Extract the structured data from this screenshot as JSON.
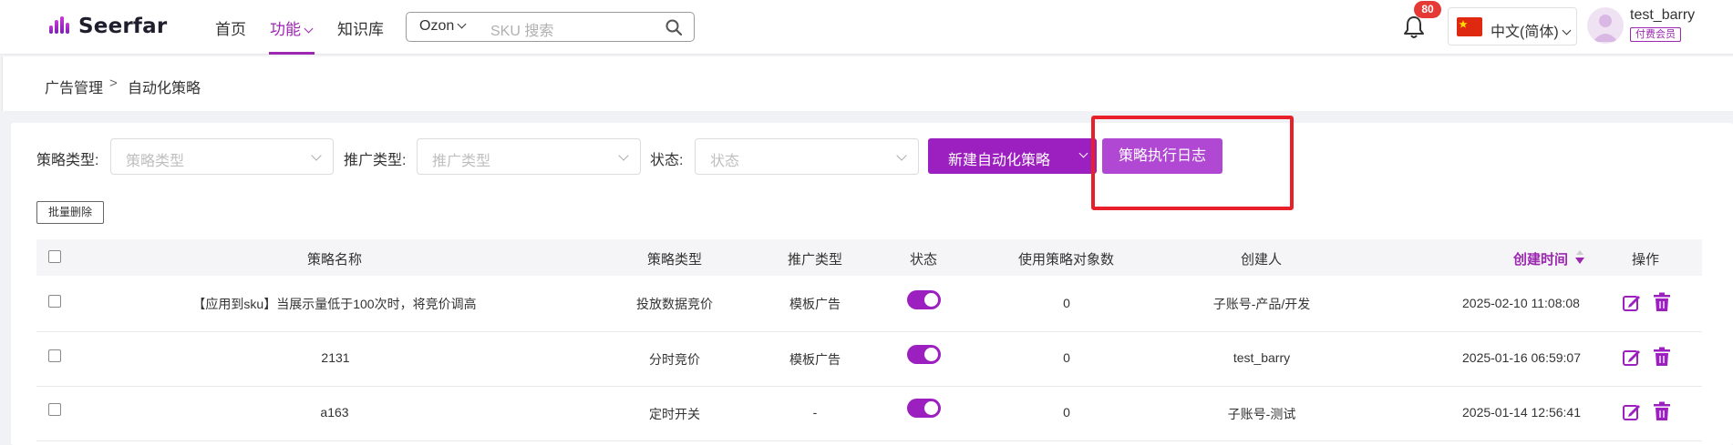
{
  "header": {
    "logo_text": "Seerfar",
    "nav": [
      {
        "label": "首页"
      },
      {
        "label": "功能"
      },
      {
        "label": "知识库"
      }
    ],
    "search": {
      "platform": "Ozon",
      "placeholder": "SKU 搜索"
    },
    "notifications": {
      "count": "80"
    },
    "language": {
      "label": "中文(简体)"
    },
    "user": {
      "name": "test_barry",
      "badge": "付费会员"
    }
  },
  "breadcrumb": {
    "items": [
      "广告管理",
      "自动化策略"
    ],
    "separator": ">"
  },
  "filters": {
    "strategy_type": {
      "label": "策略类型:",
      "placeholder": "策略类型"
    },
    "promo_type": {
      "label": "推广类型:",
      "placeholder": "推广类型"
    },
    "status": {
      "label": "状态:",
      "placeholder": "状态"
    }
  },
  "actions": {
    "new_strategy": "新建自动化策略",
    "execution_log": "策略执行日志",
    "batch_delete": "批量删除"
  },
  "table": {
    "columns": [
      "策略名称",
      "策略类型",
      "推广类型",
      "状态",
      "使用策略对象数",
      "创建人",
      "创建时间",
      "操作"
    ],
    "sorted_column": "创建时间",
    "rows": [
      {
        "name": "【应用到sku】当展示量低于100次时，将竞价调高",
        "type": "投放数据竞价",
        "promo": "模板广告",
        "enabled": true,
        "count": "0",
        "creator": "子账号-产品/开发",
        "created": "2025-02-10 11:08:08"
      },
      {
        "name": "2131",
        "type": "分时竞价",
        "promo": "模板广告",
        "enabled": true,
        "count": "0",
        "creator": "test_barry",
        "created": "2025-01-16 06:59:07"
      },
      {
        "name": "a163",
        "type": "定时开关",
        "promo": "-",
        "enabled": true,
        "count": "0",
        "creator": "子账号-测试",
        "created": "2025-01-14 12:56:41"
      }
    ]
  },
  "colors": {
    "accent": "#9c1fbf",
    "highlight": "#e8202a"
  }
}
